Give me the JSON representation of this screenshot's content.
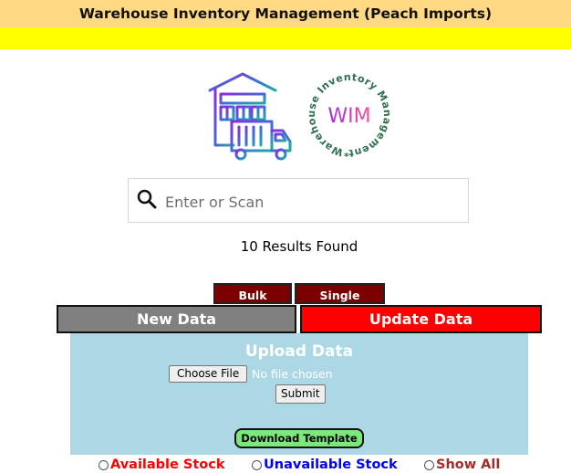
{
  "header": {
    "title": "Warehouse Inventory Management (Peach Imports)"
  },
  "logo": {
    "wim_text": "WIM",
    "wim_ring_text": "*Warehouse Inventory Management*"
  },
  "search": {
    "placeholder": "Enter or Scan",
    "value": ""
  },
  "results": {
    "text": "10 Results Found"
  },
  "upload_tabs": {
    "bulk_label": "Bulk Upload",
    "single_label": "Single Upload"
  },
  "data_tabs": {
    "new_label": "New Data",
    "update_label": "Update Data"
  },
  "upload_panel": {
    "title": "Upload Data",
    "choose_file_label": "Choose File",
    "no_file_text": "No file chosen",
    "submit_label": "Submit",
    "download_label": "Download Template"
  },
  "filters": {
    "available_label": "Available Stock",
    "unavailable_label": "Unavailable Stock",
    "all_label": "Show All"
  },
  "colors": {
    "title_bg": "#ffd983",
    "yellow_bar": "#ffff00",
    "tab_dark_red": "#7c0000",
    "new_data_bg": "#808080",
    "update_data_bg": "#ff0000",
    "panel_bg": "#acd8e6",
    "download_bg": "#7ce87c",
    "available": "#ff0000",
    "unavailable": "#0000ff",
    "show_all": "#a52a2a"
  }
}
